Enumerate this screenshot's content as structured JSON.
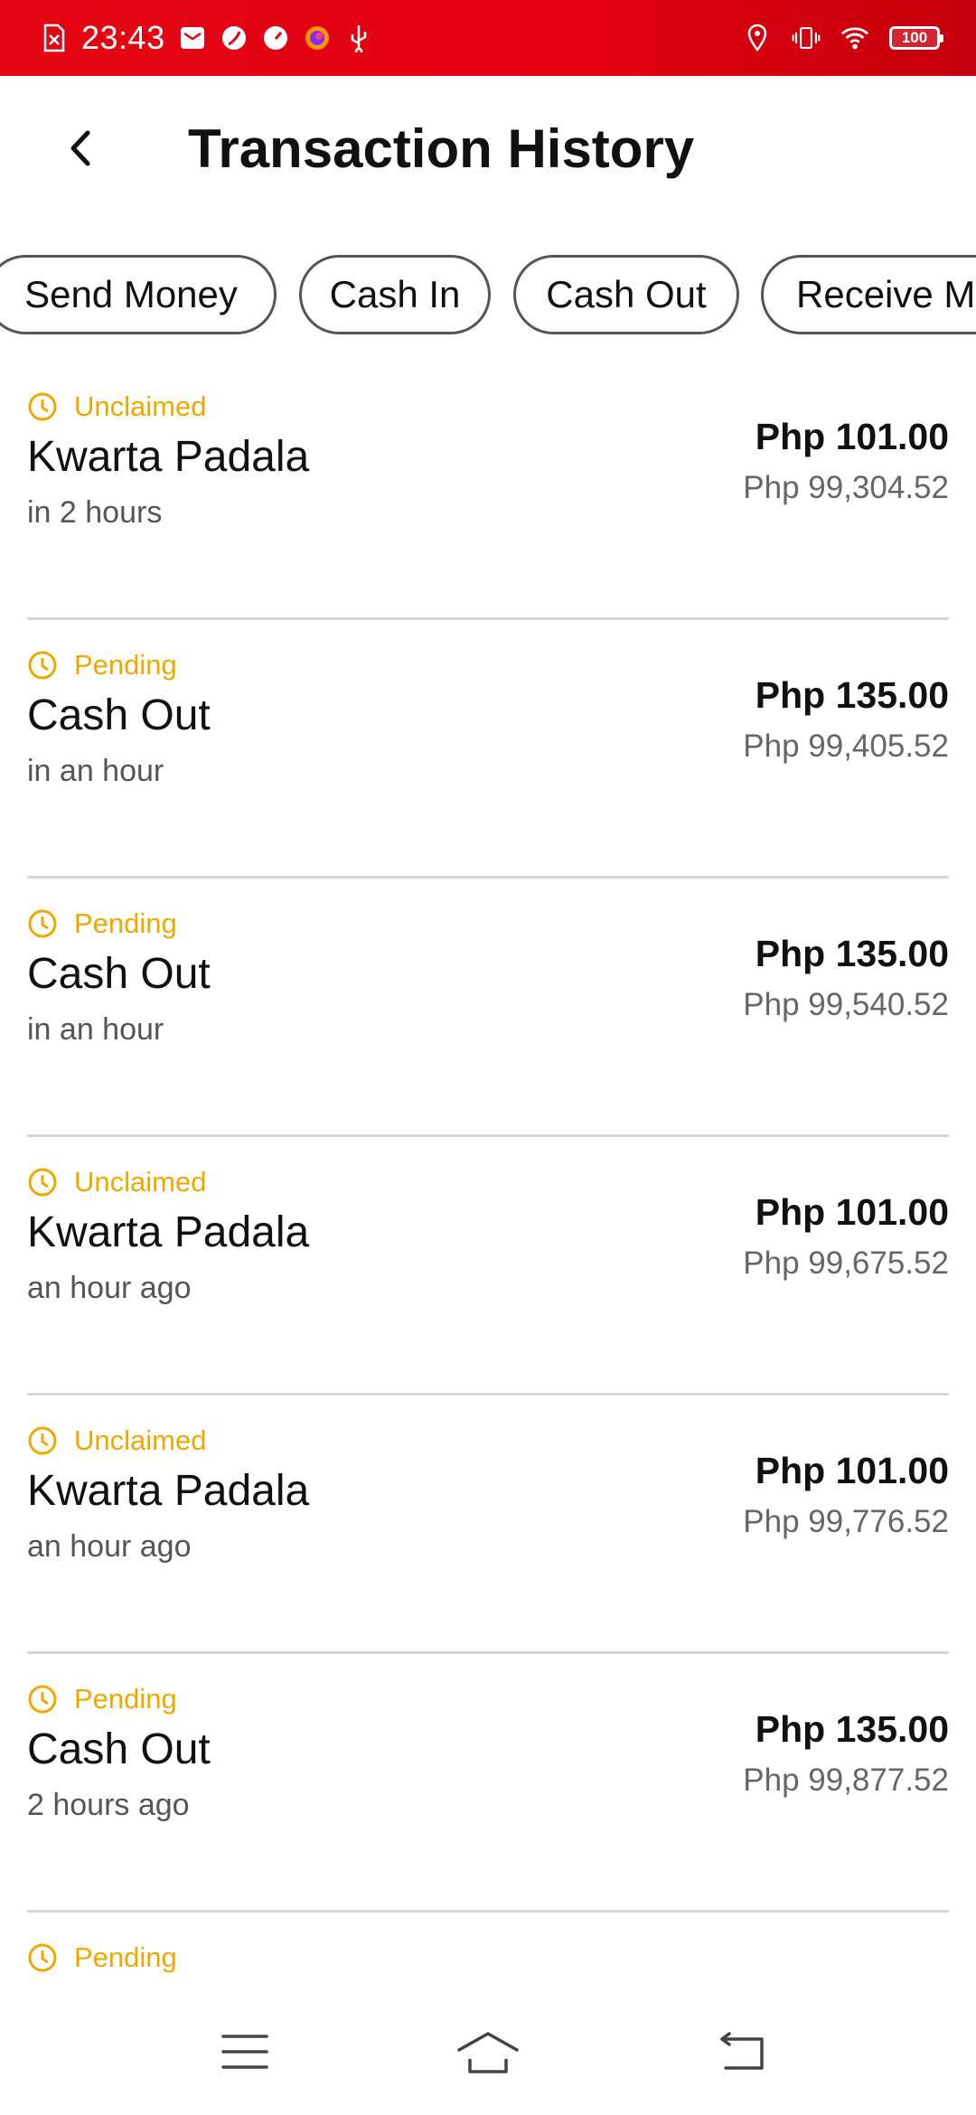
{
  "status_bar": {
    "time": "23:43",
    "battery": "100",
    "left_icons": [
      "sim-off-icon",
      "mail-icon",
      "pie-app-icon",
      "speed-icon",
      "firefox-icon",
      "usb-icon"
    ],
    "right_icons": [
      "location-icon",
      "vibrate-icon",
      "wifi-icon",
      "battery-icon"
    ],
    "background": "#e30613"
  },
  "header": {
    "title": "Transaction History",
    "back_icon": "chevron-left-icon"
  },
  "filters": [
    "Send Money",
    "Cash In",
    "Cash Out",
    "Receive Money"
  ],
  "transactions": [
    {
      "status": "Unclaimed",
      "name": "Kwarta Padala",
      "time": "in 2 hours",
      "amount": "Php 101.00",
      "balance": "Php 99,304.52"
    },
    {
      "status": "Pending",
      "name": "Cash Out",
      "time": "in an hour",
      "amount": "Php 135.00",
      "balance": "Php 99,405.52"
    },
    {
      "status": "Pending",
      "name": "Cash Out",
      "time": "in an hour",
      "amount": "Php 135.00",
      "balance": "Php 99,540.52"
    },
    {
      "status": "Unclaimed",
      "name": "Kwarta Padala",
      "time": "an hour ago",
      "amount": "Php 101.00",
      "balance": "Php 99,675.52"
    },
    {
      "status": "Unclaimed",
      "name": "Kwarta Padala",
      "time": "an hour ago",
      "amount": "Php 101.00",
      "balance": "Php 99,776.52"
    },
    {
      "status": "Pending",
      "name": "Cash Out",
      "time": "2 hours ago",
      "amount": "Php 135.00",
      "balance": "Php 99,877.52"
    },
    {
      "status": "Pending",
      "name": "",
      "time": "",
      "amount": "",
      "balance": ""
    }
  ],
  "colors": {
    "status_accent": "#f0a800",
    "divider": "#d6d6d6"
  },
  "nav_bar": {
    "icons": [
      "menu-icon",
      "home-icon",
      "back-nav-icon"
    ]
  }
}
